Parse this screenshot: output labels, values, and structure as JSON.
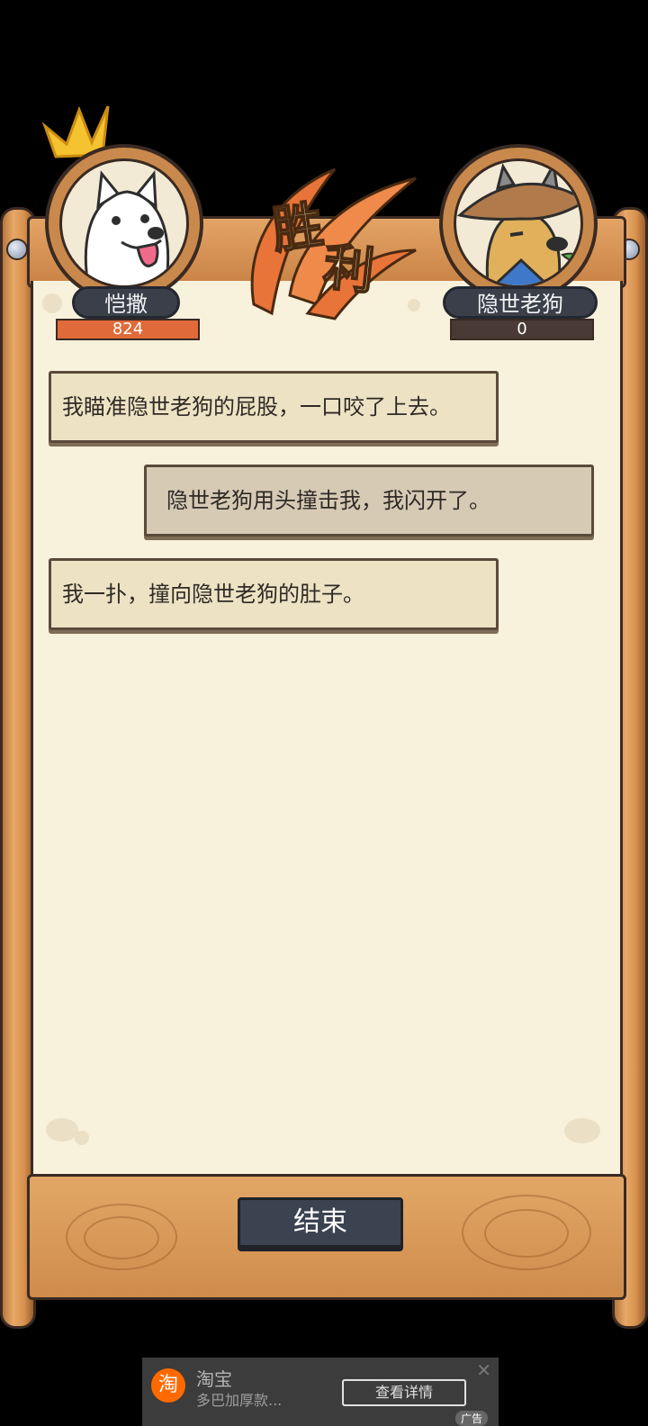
{
  "player": {
    "name": "恺撒",
    "score": "824"
  },
  "enemy": {
    "name": "隐世老狗",
    "score": "0"
  },
  "result": {
    "char1": "胜",
    "char2": "利"
  },
  "battle_log": [
    {
      "side": "mine",
      "text": "我瞄准隐世老狗的屁股，一口咬了上去。"
    },
    {
      "side": "theirs",
      "text": "隐世老狗用头撞击我，我闪开了。"
    },
    {
      "side": "mine",
      "text": "我一扑，撞向隐世老狗的肚子。"
    }
  ],
  "end_button": "结束",
  "ad": {
    "logo": "淘",
    "title": "淘宝",
    "subtitle": "多巴加厚款...",
    "button": "查看详情",
    "close": "✕",
    "tag": "广告"
  },
  "colors": {
    "player_bar": "#e06a3a",
    "enemy_bar": "#4a3a36",
    "paper": "#f8f1dc",
    "wood": "#d8914f"
  }
}
